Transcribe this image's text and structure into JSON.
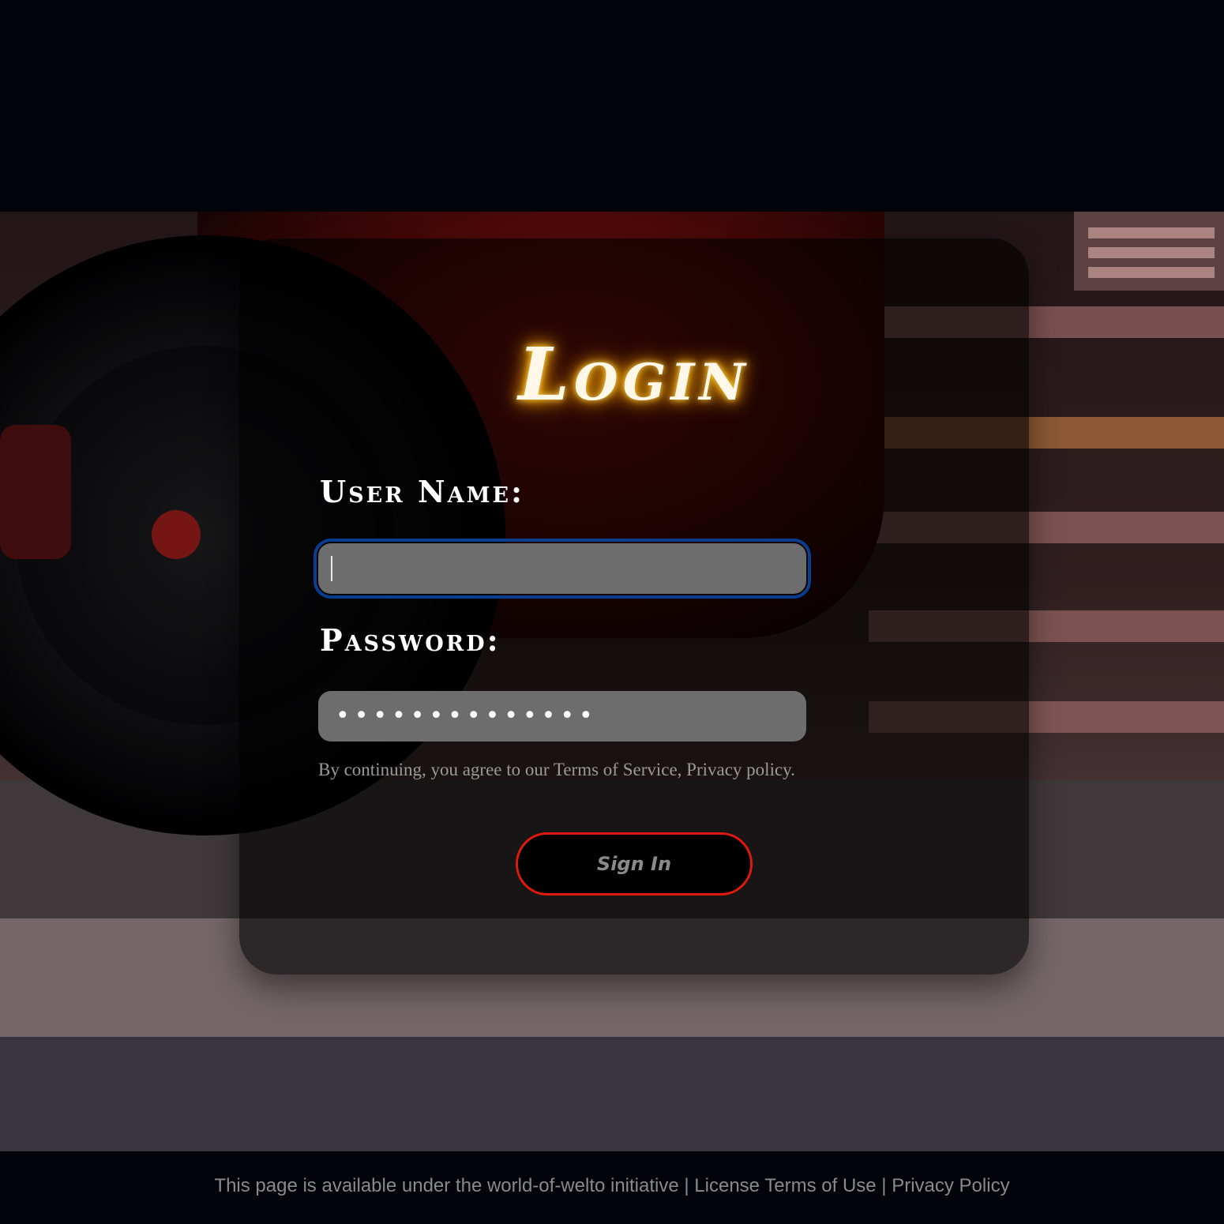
{
  "login": {
    "title": "Login",
    "username_label": "User Name:",
    "username_value": "",
    "password_label": "Password:",
    "password_value": "••••••••••••••",
    "terms_text": "By continuing, you agree to our Terms of Service, Privacy policy.",
    "signin_label": "Sign In"
  },
  "footer": {
    "notice": "This page is available under the world-of-welto initiative",
    "separator": "|",
    "license_link": "License Terms of Use",
    "privacy_link": "Privacy Policy"
  },
  "colors": {
    "title_glow": "#ffb300",
    "field_bg": "#6d6d6d",
    "focus_outline": "#0a3d8f",
    "signin_border": "#e0190f",
    "page_bg": "#03030a"
  },
  "icons": {
    "background": "night-car-crosswalk-photo"
  }
}
